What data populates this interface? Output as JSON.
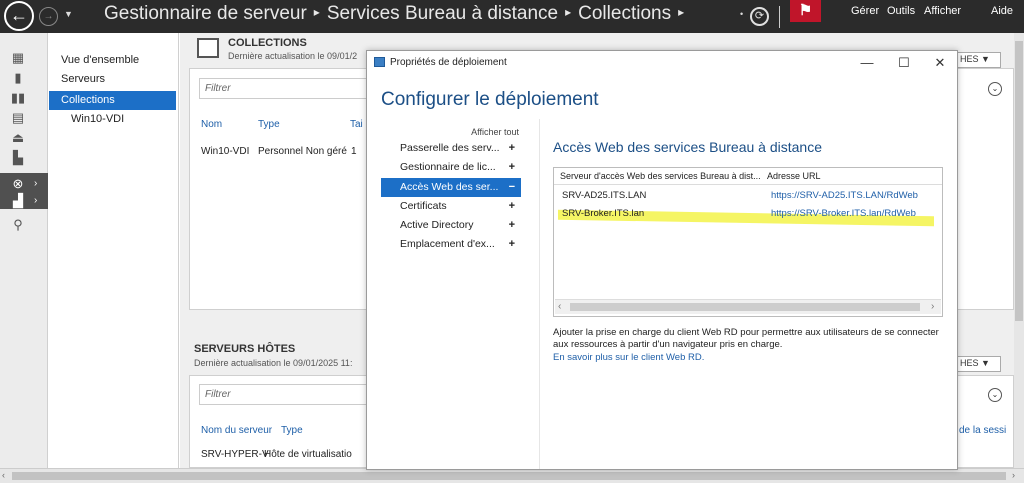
{
  "titlebar": {
    "breadcrumb": [
      "Gestionnaire de serveur",
      "Services Bureau à distance",
      "Collections"
    ],
    "sep_glyph": "▸",
    "menus": [
      "Gérer",
      "Outils",
      "Afficher",
      "Aide"
    ]
  },
  "nav": {
    "items": [
      {
        "label": "Vue d'ensemble"
      },
      {
        "label": "Serveurs"
      },
      {
        "label": "Collections",
        "selected": true
      },
      {
        "label": "Win10-VDI"
      }
    ]
  },
  "collections": {
    "title": "COLLECTIONS",
    "subtitle": "Dernière actualisation le 09/01/2",
    "filter_placeholder": "Filtrer",
    "columns": [
      "Nom",
      "Type",
      "Tai"
    ],
    "row": [
      "Win10-VDI",
      "Personnel Non géré",
      "1"
    ],
    "taches_label": "HES"
  },
  "hosts": {
    "title": "SERVEURS HÔTES",
    "subtitle": "Dernière actualisation le 09/01/2025 11:",
    "filter_placeholder": "Filtrer",
    "columns": [
      "Nom du serveur",
      "Type"
    ],
    "row": [
      "SRV-HYPER-V",
      "Hôte de virtualisatio"
    ],
    "right_col": "de la sessi",
    "taches_label": "HES"
  },
  "dialog": {
    "title": "Propriétés de déploiement",
    "header": "Configurer le déploiement",
    "show_all": "Afficher tout",
    "nav": [
      {
        "label": "Passerelle des serv...",
        "sign": "+"
      },
      {
        "label": "Gestionnaire de lic...",
        "sign": "+"
      },
      {
        "label": "Accès Web des ser...",
        "sign": "−",
        "selected": true
      },
      {
        "label": "Certificats",
        "sign": "+"
      },
      {
        "label": "Active Directory",
        "sign": "+"
      },
      {
        "label": "Emplacement d'ex...",
        "sign": "+"
      }
    ],
    "content_title": "Accès Web des services Bureau à distance",
    "list_columns": [
      "Serveur d'accès Web des services Bureau à dist...",
      "Adresse URL"
    ],
    "list_rows": [
      {
        "server": "SRV-AD25.ITS.LAN",
        "url": "https://SRV-AD25.ITS.LAN/RdWeb"
      },
      {
        "server": "SRV-Broker.ITS.lan",
        "url": "https://SRV-Broker.ITS.lan/RdWeb"
      }
    ],
    "description": "Ajouter la prise en charge du client Web RD pour permettre aux utilisateurs de se connecter aux ressources à partir d'un navigateur pris en charge.",
    "learn_more": "En savoir plus sur le client Web RD."
  },
  "colors": {
    "accent": "#1c6fc7",
    "titlebar": "#2b2b2b",
    "flag": "#c0152a",
    "highlight": "#f2f23d"
  }
}
